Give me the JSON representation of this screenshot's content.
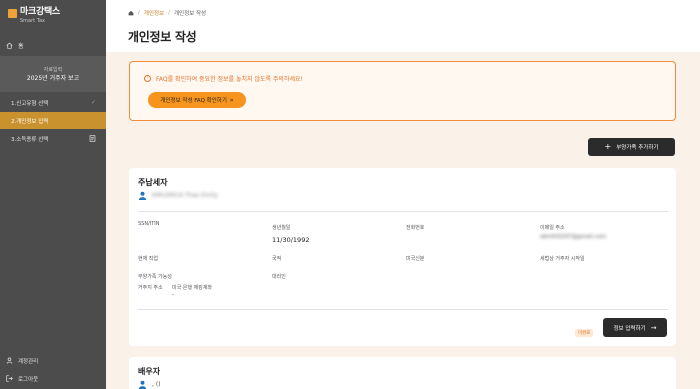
{
  "sidebar": {
    "brand": "마크강택스",
    "brand_sub": "Smart Tax",
    "home": "홈",
    "info_sub": "자료입력",
    "info_title": "2025년 거주자 보고",
    "items": [
      {
        "label": "1.신고유형 선택"
      },
      {
        "label": "2.개인정보 입력"
      },
      {
        "label": "3.소득종류 선택"
      }
    ],
    "account": "계정관리",
    "logout": "로그아웃"
  },
  "header": {
    "breadcrumb": [
      "개인정보",
      "개인정보 작성"
    ],
    "title": "개인정보 작성"
  },
  "notice": {
    "text": "FAQ를 확인하여 중요한 정보를 놓치지 않도록 주의하세요!",
    "button": "개인정보 작성 FAQ 확인하기"
  },
  "add_dependent": "부양가족 추가하기",
  "taxpayer": {
    "title": "주납세자",
    "name": "KIM,ERICA Thao Emily",
    "fields": {
      "ssn_label": "SSN/ITIN",
      "birth_label": "생년월일",
      "birth_value": "11/30/1992",
      "phone_label": "전화번호",
      "email_label": "이메일 주소",
      "email_value": "ebmth0247@gmail.com",
      "job_label": "현재 직업",
      "nationality_label": "국적",
      "status_label": "미국신분",
      "residence_start_label": "세법상 거주자 시작일",
      "dependent_label": "부양가족 가능성",
      "proxy_label": "대리인",
      "address_label": "거주지 주소",
      "bank_label": "미국 은행 체킹계좌",
      "bank_value": "-"
    },
    "tag": "미완료",
    "enter_button": "정보 입력하기"
  },
  "spouse": {
    "title": "배우자",
    "name_suffix": ", ()"
  }
}
